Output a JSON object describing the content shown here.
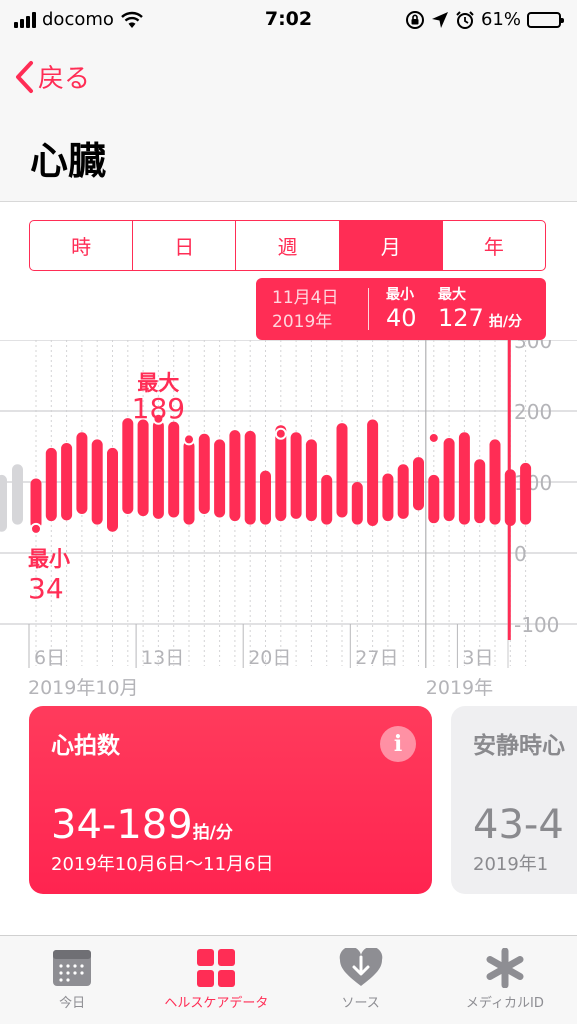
{
  "status": {
    "carrier": "docomo",
    "time": "7:02",
    "battery": "61%",
    "battery_level": 0.61
  },
  "nav": {
    "back_label": "戻る",
    "title": "心臓"
  },
  "segments": [
    {
      "label": "時",
      "active": false
    },
    {
      "label": "日",
      "active": false
    },
    {
      "label": "週",
      "active": false
    },
    {
      "label": "月",
      "active": true
    },
    {
      "label": "年",
      "active": false
    }
  ],
  "tooltip": {
    "date": "11月4日",
    "year": "2019年",
    "min_label": "最小",
    "min_value": "40",
    "max_label": "最大",
    "max_value": "127",
    "unit": "拍/分"
  },
  "chart_data": {
    "type": "bar",
    "ylim": [
      -100,
      300
    ],
    "y_ticks": [
      "300",
      "200",
      "100",
      "0",
      "-100"
    ],
    "x_ticks": [
      {
        "label": "6日",
        "index": 0
      },
      {
        "label": "13日",
        "index": 7
      },
      {
        "label": "20日",
        "index": 14
      },
      {
        "label": "27日",
        "index": 21
      },
      {
        "label": "3日",
        "index": 28
      }
    ],
    "x_sublabels": [
      {
        "label": "2019年10月",
        "index": 0
      },
      {
        "label": "2019年",
        "index": 26
      }
    ],
    "ghost_ranges": [
      [
        30,
        110
      ],
      [
        40,
        125
      ]
    ],
    "ranges": [
      [
        34,
        105
      ],
      [
        45,
        148
      ],
      [
        46,
        155
      ],
      [
        55,
        170
      ],
      [
        40,
        160
      ],
      [
        30,
        148
      ],
      [
        55,
        190
      ],
      [
        52,
        188
      ],
      [
        48,
        187
      ],
      [
        50,
        185
      ],
      [
        40,
        158
      ],
      [
        55,
        168
      ],
      [
        50,
        160
      ],
      [
        45,
        173
      ],
      [
        40,
        172
      ],
      [
        40,
        116
      ],
      [
        45,
        180
      ],
      [
        48,
        170
      ],
      [
        45,
        160
      ],
      [
        40,
        110
      ],
      [
        50,
        183
      ],
      [
        40,
        100
      ],
      [
        38,
        188
      ],
      [
        45,
        112
      ],
      [
        48,
        125
      ],
      [
        60,
        135
      ],
      [
        42,
        110
      ],
      [
        45,
        162
      ],
      [
        40,
        170
      ],
      [
        42,
        132
      ],
      [
        40,
        160
      ],
      [
        38,
        118
      ],
      [
        40,
        127
      ]
    ],
    "dots": [
      {
        "index": 0,
        "value": 34
      },
      {
        "index": 8,
        "value": 189
      },
      {
        "index": 10,
        "value": 160
      },
      {
        "index": 16,
        "value": 168
      },
      {
        "index": 26,
        "value": 162
      }
    ],
    "max_annotation": {
      "label": "最大",
      "value": "189",
      "index": 8
    },
    "min_annotation": {
      "label": "最小",
      "value": "34",
      "index": 0
    },
    "selected_index": 31,
    "bar_color": "#ff2d55",
    "ghost_color": "#d6d6d9"
  },
  "cards": [
    {
      "title": "心拍数",
      "range": "34-189",
      "unit": "拍/分",
      "dates": "2019年10月6日～11月6日",
      "info_label": "i"
    },
    {
      "title": "安静時心",
      "range": "43-4",
      "dates": "2019年1"
    }
  ],
  "tabs": [
    {
      "label": "今日",
      "icon": "calendar-icon",
      "active": false
    },
    {
      "label": "ヘルスケアデータ",
      "icon": "grid-icon",
      "active": true
    },
    {
      "label": "ソース",
      "icon": "heart-download-icon",
      "active": false
    },
    {
      "label": "メディカルID",
      "icon": "asterisk-icon",
      "active": false
    }
  ]
}
